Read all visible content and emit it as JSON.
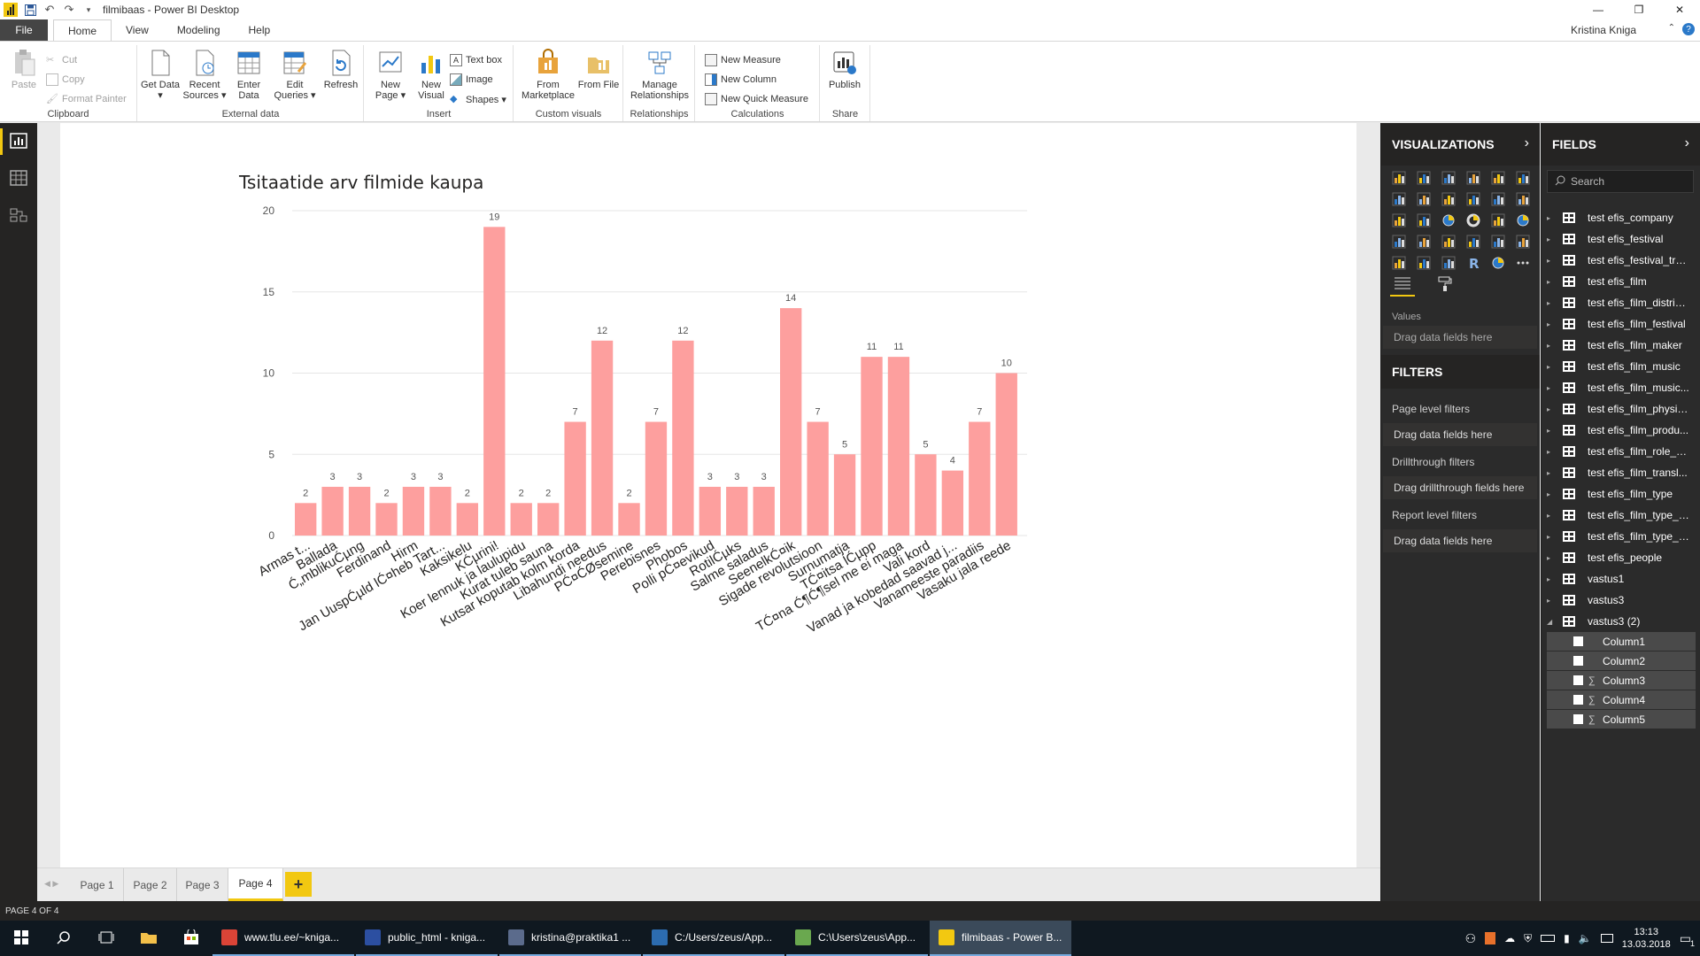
{
  "window": {
    "title": "filmibaas - Power BI Desktop",
    "user": "Kristina Kniga",
    "minimize": "—",
    "maximize": "❐",
    "close": "✕"
  },
  "ribbon_tabs": [
    {
      "label": "File"
    },
    {
      "label": "Home"
    },
    {
      "label": "View"
    },
    {
      "label": "Modeling"
    },
    {
      "label": "Help"
    }
  ],
  "ribbon": {
    "clipboard": {
      "label": "Clipboard",
      "paste": "Paste",
      "cut": "Cut",
      "copy": "Copy",
      "format_painter": "Format Painter"
    },
    "external": {
      "label": "External data",
      "get_data": "Get Data ▾",
      "recent_sources": "Recent Sources ▾",
      "enter_data": "Enter Data",
      "edit_queries": "Edit Queries ▾",
      "refresh": "Refresh"
    },
    "insert": {
      "label": "Insert",
      "new_page": "New Page ▾",
      "new_visual": "New Visual",
      "text_box": "Text box",
      "image": "Image",
      "shapes": "Shapes ▾"
    },
    "custom_visuals": {
      "label": "Custom visuals",
      "from_marketplace": "From Marketplace",
      "from_file": "From File"
    },
    "relationships": {
      "label": "Relationships",
      "manage": "Manage Relationships"
    },
    "calculations": {
      "label": "Calculations",
      "new_measure": "New Measure",
      "new_column": "New Column",
      "new_quick_measure": "New Quick Measure"
    },
    "share": {
      "label": "Share",
      "publish": "Publish"
    }
  },
  "visualizations": {
    "title": "VISUALIZATIONS",
    "values_label": "Values",
    "drop_values": "Drag data fields here"
  },
  "filters": {
    "title": "FILTERS",
    "page_level": "Page level filters",
    "drop_page": "Drag data fields here",
    "drillthrough": "Drillthrough filters",
    "drop_drill": "Drag drillthrough fields here",
    "report_level": "Report level filters",
    "drop_report": "Drag data fields here"
  },
  "fields": {
    "title": "FIELDS",
    "search_placeholder": "Search",
    "tables": [
      "test efis_company",
      "test efis_festival",
      "test efis_festival_tra...",
      "test efis_film",
      "test efis_film_distrib...",
      "test efis_film_festival",
      "test efis_film_maker",
      "test efis_film_music",
      "test efis_film_music...",
      "test efis_film_physic...",
      "test efis_film_produ...",
      "test efis_film_role_p...",
      "test efis_film_transl...",
      "test efis_film_type",
      "test efis_film_type_rel",
      "test efis_film_type_t...",
      "test efis_people",
      "vastus1",
      "vastus3",
      "vastus3 (2)"
    ],
    "columns": [
      {
        "name": "Column1",
        "sigma": false
      },
      {
        "name": "Column2",
        "sigma": false
      },
      {
        "name": "Column3",
        "sigma": true
      },
      {
        "name": "Column4",
        "sigma": true
      },
      {
        "name": "Column5",
        "sigma": true
      }
    ]
  },
  "pages": {
    "tabs": [
      "Page 1",
      "Page 2",
      "Page 3",
      "Page 4"
    ],
    "active": "Page 4",
    "add": "+",
    "status": "PAGE 4 OF 4"
  },
  "taskbar": {
    "apps": [
      {
        "label": "www.tlu.ee/~kniga...",
        "color": "#db4437"
      },
      {
        "label": "public_html - kniga...",
        "color": "#2c4fa1"
      },
      {
        "label": "kristina@praktika1 ...",
        "color": "#5b6b8c"
      },
      {
        "label": "C:/Users/zeus/App...",
        "color": "#2c6cb0"
      },
      {
        "label": "C:\\Users\\zeus\\App...",
        "color": "#6aa84f"
      },
      {
        "label": "filmibaas - Power B...",
        "color": "#f2c811"
      }
    ],
    "time": "13:13",
    "date": "13.03.2018",
    "notifications": "1"
  },
  "chart_data": {
    "type": "bar",
    "title": "Tsitaatide arv filmide kaupa",
    "xlabel": "",
    "ylabel": "",
    "ylim": [
      0,
      20
    ],
    "yticks": [
      0,
      5,
      10,
      15,
      20
    ],
    "color": "#fd9f9e",
    "categories": [
      "Armas t...",
      "Ballada",
      "Ć„mblikuĆµng",
      "Ferdinand",
      "Hirm",
      "Jan UuspĆµld lĆ¤heb Tart...",
      "Kaksikelu",
      "KĆµrini!",
      "Koer lennuk ja laulupidu",
      "Kurat tuleb sauna",
      "Kutsar koputab kolm korda",
      "Libahundi needus",
      "PĆ¤ĆØsemine",
      "Perebisnes",
      "Phobos",
      "Polli pĆ¤evikud",
      "RotilĆµks",
      "Salme saladus",
      "SeenelkĆ¤ik",
      "Sigade revolutsioon",
      "Surnumatja",
      "TĆ¤itsa lĆµpp",
      "TĆ¤na Ć¶Ć¶sel me ei maga",
      "Vali kord",
      "Vanad ja kobedad saavad j...",
      "Vanameeste paradiis",
      "Vasaku jala reede"
    ],
    "values": [
      2,
      3,
      3,
      2,
      3,
      3,
      2,
      19,
      2,
      2,
      7,
      12,
      2,
      7,
      12,
      3,
      3,
      3,
      14,
      7,
      5,
      11,
      11,
      5,
      4,
      7,
      10
    ]
  }
}
